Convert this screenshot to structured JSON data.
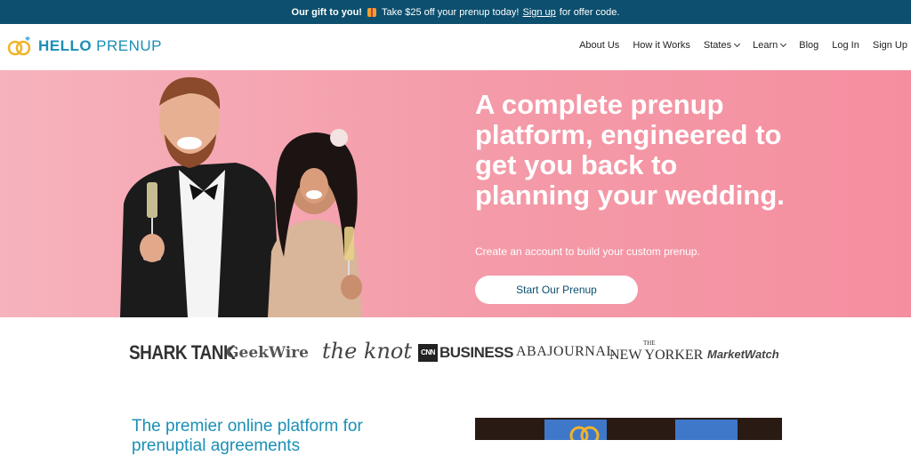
{
  "promo": {
    "lead": "Our gift to you!",
    "text": "Take $25 off your prenup today!",
    "link": "Sign up",
    "tail": "for offer code."
  },
  "brand": {
    "word1": "HELLO",
    "word2": "PRENUP",
    "color": "#1a8fb5"
  },
  "nav": {
    "about": "About Us",
    "how": "How it Works",
    "states": "States",
    "learn": "Learn",
    "blog": "Blog",
    "login": "Log In",
    "signup": "Sign Up"
  },
  "hero": {
    "title": "A complete prenup platform, engineered to get you back to planning your wedding.",
    "subtitle": "Create an account to build your custom prenup.",
    "cta": "Start Our Prenup"
  },
  "press": {
    "shark": "SHARK TANK",
    "geek": "GeekWire",
    "knot": "the knot",
    "cnn": "CNN",
    "business": "BUSINESS",
    "aba": "ABAJOURNAL",
    "ny_the": "THE",
    "ny": "NEW YORKER",
    "mw": "MarketWatch"
  },
  "section": {
    "heading": "The premier online platform for prenuptial agreements"
  },
  "colors": {
    "promo_bg": "#0c4f6e",
    "hero_bg": "#f49aa8",
    "accent": "#1a8fb5"
  }
}
